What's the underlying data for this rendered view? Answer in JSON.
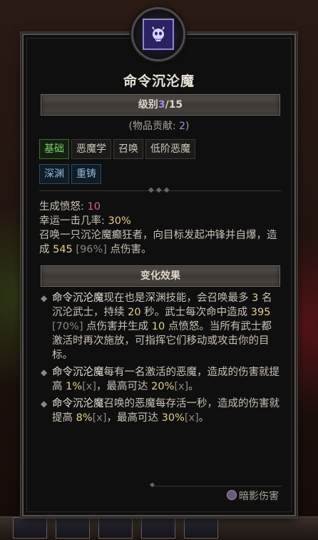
{
  "skill": {
    "name": "命令沉沦魔",
    "rank_label": "级别",
    "rank_current": "3",
    "rank_sep": "/",
    "rank_max": "15",
    "contrib_prefix": "(物品贡献: ",
    "contrib_value": "2",
    "contrib_suffix": ")",
    "icon": "skull-demon-icon"
  },
  "tags": [
    {
      "label": "基础",
      "color": "green"
    },
    {
      "label": "恶魔学",
      "color": "default"
    },
    {
      "label": "召唤",
      "color": "default"
    },
    {
      "label": "低阶恶魔",
      "color": "default"
    },
    {
      "label": "深渊",
      "color": "blue"
    },
    {
      "label": "重铸",
      "color": "blue"
    }
  ],
  "stats": {
    "wrath_label": "生成愤怒: ",
    "wrath_value": "10",
    "lucky_label": "幸运一击几率: ",
    "lucky_value": "30%",
    "desc_a": "召唤一只沉沦魔癫狂者，向目标发起冲锋并自爆，造成 ",
    "desc_dmg": "545",
    "desc_pct": " [96%]",
    "desc_b": " 点伤害。"
  },
  "effects_title": "变化效果",
  "effects": {
    "e1": {
      "name": "命令沉沦魔",
      "t1": "现在也是深渊技能，会召唤最多 ",
      "n1": "3",
      "t2": " 名沉沦武士，持续 ",
      "n2": "20",
      "t3": " 秒。武士每次命中造成 ",
      "n3": "395",
      "p3": " [70%]",
      "t4": " 点伤害并生成 ",
      "n4": "10",
      "t5": " 点愤怒。当所有武士都激活时再次施放，可指挥它们移动或攻击你的目标。"
    },
    "e2": {
      "name": "命令沉沦魔",
      "t1": "每有一名激活的恶魔，造成的伤害就提高 ",
      "n1": "1%",
      "x1": "[x]",
      "t2": "，最高可达 ",
      "n2": "20%",
      "x2": "[x]",
      "t3": "。"
    },
    "e3": {
      "name": "命令沉沦魔",
      "t1": "召唤的恶魔每存活一秒，造成的伤害就提高 ",
      "n1": "8%",
      "x1": "[x]",
      "t2": "，最高可达 ",
      "n2": "30%",
      "x2": "[x]",
      "t3": "。"
    }
  },
  "damage_type": "暗影伤害",
  "colors": {
    "rank": "#9d8fe8",
    "wrath": "#d55fa0",
    "value": "#e6cf8d",
    "tag_green": "#7ecf6b",
    "tag_blue": "#8fb8d8"
  }
}
